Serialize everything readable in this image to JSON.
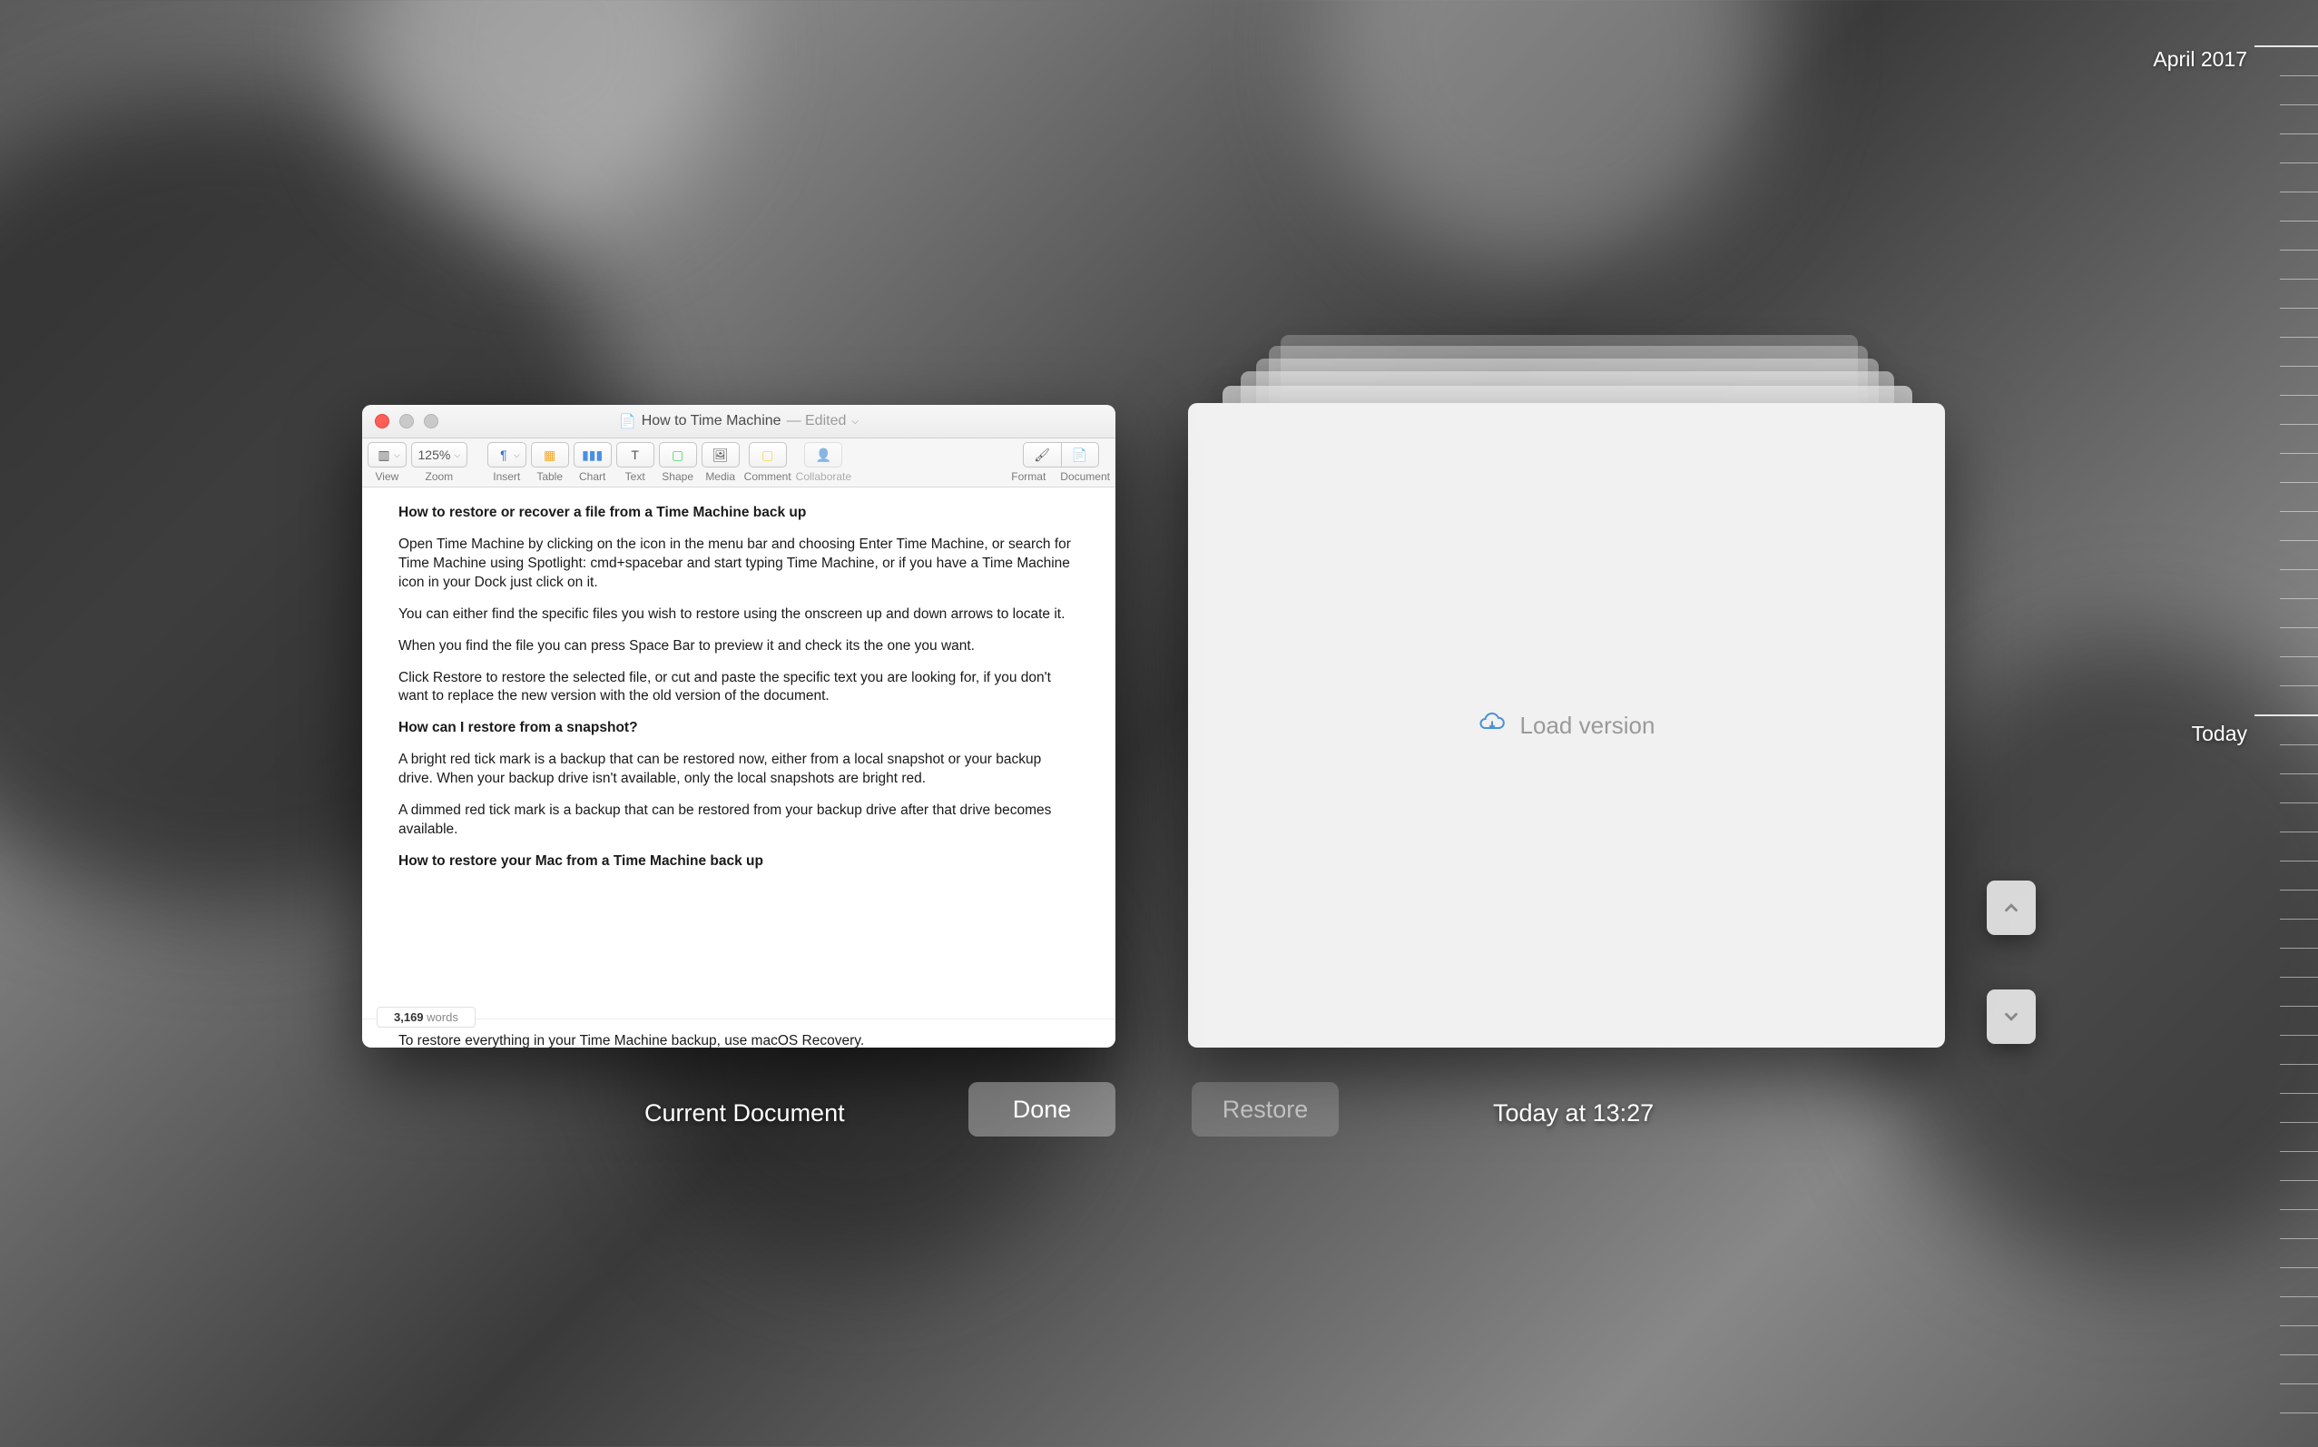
{
  "timeline": {
    "top_label": "April 2017",
    "mid_label": "Today"
  },
  "window": {
    "title_doc": "How to Time Machine",
    "title_status": "— Edited",
    "toolbar": {
      "view": "View",
      "zoom_value": "125%",
      "zoom": "Zoom",
      "insert": "Insert",
      "table": "Table",
      "chart": "Chart",
      "text": "Text",
      "shape": "Shape",
      "media": "Media",
      "comment": "Comment",
      "collaborate": "Collaborate",
      "format": "Format",
      "document": "Document"
    },
    "body": {
      "h1": "How to restore or recover a file from a Time Machine back up",
      "p1": "Open Time Machine by clicking on the icon in the menu bar and choosing Enter Time Machine, or search for Time Machine using Spotlight: cmd+spacebar and start typing Time Machine, or if you have a Time Machine icon in your Dock just click on it.",
      "p2": "You can either find the specific files you wish to restore using the onscreen up and down arrows to locate it.",
      "p3": "When you find the file you can press Space Bar to preview it and check its the one you want.",
      "p4": "Click Restore to restore the selected file, or cut and paste the specific text you are looking for, if you don't want to replace the new version with the old version of the document.",
      "h2": "How can I restore from a snapshot?",
      "p5": "A bright red tick mark is a backup that can be restored now, either from a local snapshot or your backup drive. When your backup drive isn't available, only the local snapshots are bright red.",
      "p6": "A dimmed red tick mark is a backup that can be restored from your backup drive after that drive becomes available.",
      "h3": "How to restore your Mac from a Time Machine back up",
      "truncated": "To restore everything in your Time Machine backup, use macOS Recovery."
    },
    "footer": {
      "word_count": "3,169",
      "word_label": "words"
    }
  },
  "load_version_label": "Load version",
  "bottom": {
    "current": "Current Document",
    "done": "Done",
    "restore": "Restore",
    "timestamp": "Today at 13:27"
  }
}
